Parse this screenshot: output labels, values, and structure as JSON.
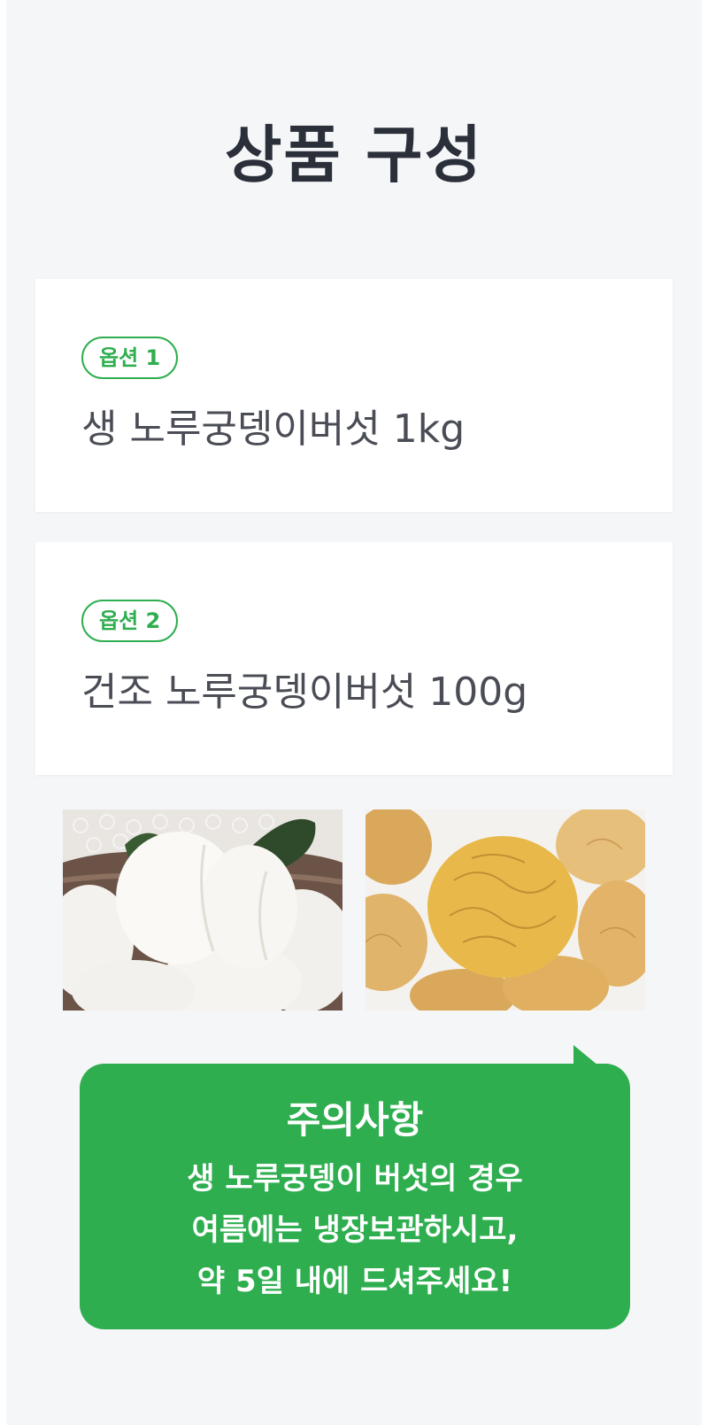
{
  "page": {
    "title": "상품 구성"
  },
  "options": [
    {
      "badge": "옵션 1",
      "name": "생 노루궁뎅이버섯 1kg"
    },
    {
      "badge": "옵션 2",
      "name": "건조 노루궁뎅이버섯 100g"
    }
  ],
  "images": [
    {
      "name": "fresh-lions-mane-photo",
      "description_icon": "photo-icon"
    },
    {
      "name": "dried-lions-mane-photo",
      "description_icon": "photo-icon"
    }
  ],
  "notice": {
    "title": "주의사항",
    "lines": [
      "생 노루궁뎅이 버섯의 경우",
      "여름에는 냉장보관하시고,",
      "약 5일 내에 드셔주세요!"
    ]
  },
  "colors": {
    "accent": "#2eae4f",
    "background": "#f5f6f8",
    "title_text": "#2b2f3a",
    "body_text": "#4a4d55"
  }
}
